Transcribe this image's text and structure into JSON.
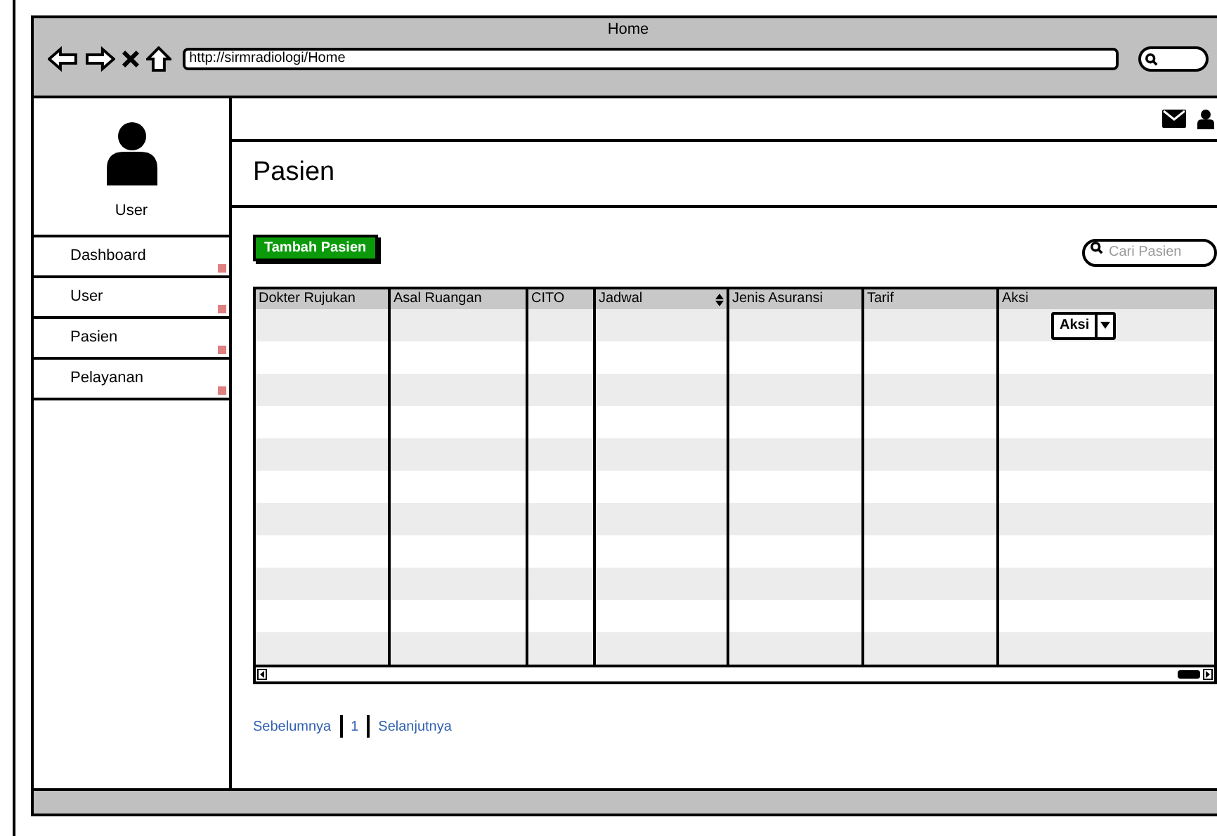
{
  "window": {
    "title": "Home",
    "url": "http://sirmradiologi/Home"
  },
  "sidebar": {
    "user_label": "User",
    "items": [
      {
        "label": "Dashboard"
      },
      {
        "label": "User"
      },
      {
        "label": "Pasien"
      },
      {
        "label": "Pelayanan"
      }
    ]
  },
  "page": {
    "title": "Pasien",
    "add_button": "Tambah Pasien",
    "search": {
      "placeholder": "Cari Pasien"
    }
  },
  "table": {
    "columns": [
      {
        "label": "Dokter Rujukan",
        "sortable": false
      },
      {
        "label": "Asal Ruangan",
        "sortable": false
      },
      {
        "label": "CITO",
        "sortable": false
      },
      {
        "label": "Jadwal",
        "sortable": true
      },
      {
        "label": "Jenis Asuransi",
        "sortable": false
      },
      {
        "label": "Tarif",
        "sortable": false
      },
      {
        "label": "Aksi",
        "sortable": false
      }
    ],
    "rows": [
      {
        "action": "Aksi"
      }
    ]
  },
  "pagination": {
    "previous": "Sebelumnya",
    "page": "1",
    "next": "Selanjutnya"
  }
}
